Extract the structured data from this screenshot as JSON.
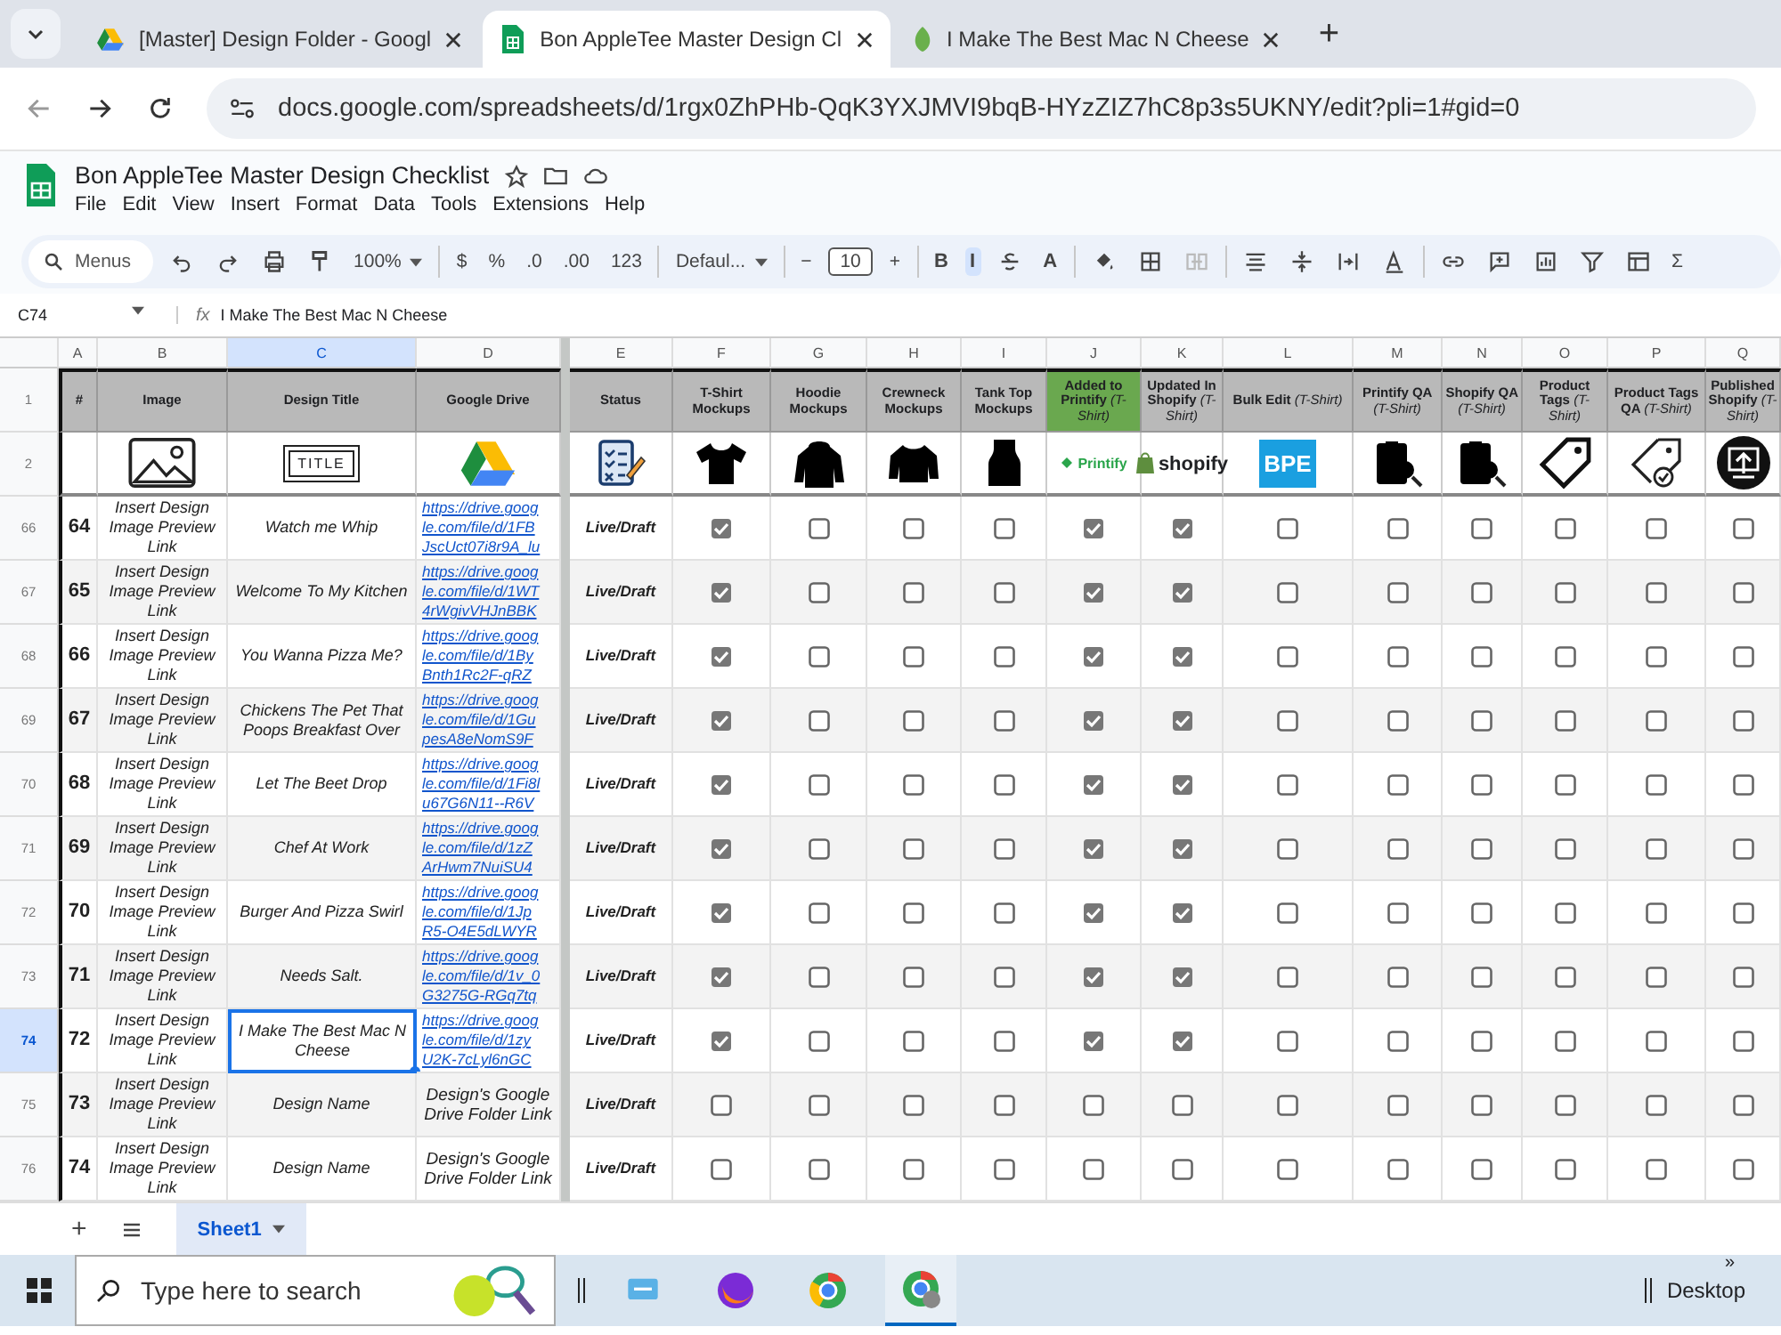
{
  "browser": {
    "tabs": [
      {
        "title": "[Master] Design Folder - Googl",
        "selected": false
      },
      {
        "title": "Bon AppleTee Master Design Cl",
        "selected": true
      },
      {
        "title": "I Make The Best Mac N Cheese",
        "selected": false
      }
    ],
    "new_tab": "+",
    "url": "docs.google.com/spreadsheets/d/1rgx0ZhPHb-QqK3YXJMVI9bqB-HYzZIZ7hC8p3s5UKNY/edit?pli=1#gid=0"
  },
  "document": {
    "title": "Bon AppleTee Master Design Checklist",
    "menus": [
      "File",
      "Edit",
      "View",
      "Insert",
      "Format",
      "Data",
      "Tools",
      "Extensions",
      "Help"
    ]
  },
  "toolbar": [
    {
      "kind": "search",
      "text": "Menus"
    },
    {
      "kind": "undo"
    },
    {
      "kind": "redo"
    },
    {
      "kind": "print"
    },
    {
      "kind": "paint"
    },
    {
      "kind": "dropdown",
      "text": "100%"
    },
    {
      "kind": "sep"
    },
    {
      "kind": "text",
      "text": "$"
    },
    {
      "kind": "text",
      "text": "%"
    },
    {
      "kind": "text",
      "text": ".0"
    },
    {
      "kind": "text",
      "text": ".00"
    },
    {
      "kind": "text",
      "text": "123"
    },
    {
      "kind": "sep"
    },
    {
      "kind": "dropdown",
      "text": "Defaul..."
    },
    {
      "kind": "sep"
    },
    {
      "kind": "text",
      "text": "−"
    },
    {
      "kind": "field",
      "text": "10"
    },
    {
      "kind": "text",
      "text": "+"
    },
    {
      "kind": "sep"
    },
    {
      "kind": "style",
      "text": "B",
      "selected": false
    },
    {
      "kind": "style",
      "text": "I",
      "selected": true
    },
    {
      "kind": "strike"
    },
    {
      "kind": "style",
      "text": "A",
      "selected": false
    },
    {
      "kind": "sep"
    },
    {
      "kind": "fill"
    },
    {
      "kind": "borders"
    },
    {
      "kind": "merge"
    },
    {
      "kind": "sep"
    },
    {
      "kind": "align"
    },
    {
      "kind": "valign"
    },
    {
      "kind": "wrap"
    },
    {
      "kind": "rotate"
    },
    {
      "kind": "sep"
    },
    {
      "kind": "link"
    },
    {
      "kind": "comment"
    },
    {
      "kind": "chart"
    },
    {
      "kind": "filter"
    },
    {
      "kind": "views"
    },
    {
      "kind": "text",
      "text": "Σ"
    }
  ],
  "formula_bar": {
    "cell": "C74",
    "fx": "fx",
    "value": "I Make The Best Mac N Cheese"
  },
  "columns": [
    {
      "letter": "A",
      "label": "#",
      "highlighted": false,
      "kind": "none",
      "selected": false
    },
    {
      "letter": "B",
      "label": "Image",
      "highlighted": false,
      "kind": "image",
      "selected": false
    },
    {
      "letter": "C",
      "label": "Design Title",
      "highlighted": false,
      "kind": "title",
      "logo_text": "TITLE",
      "selected": true
    },
    {
      "letter": "D",
      "label": "Google Drive",
      "highlighted": false,
      "kind": "drive",
      "selected": false
    },
    {
      "letter": "E",
      "label": "Status",
      "highlighted": false,
      "kind": "checklist",
      "selected": false
    },
    {
      "letter": "F",
      "label": "T-Shirt Mockups",
      "highlighted": false,
      "kind": "tshirt",
      "selected": false
    },
    {
      "letter": "G",
      "label": "Hoodie Mockups",
      "highlighted": false,
      "kind": "hoodie",
      "selected": false
    },
    {
      "letter": "H",
      "label": "Crewneck Mockups",
      "highlighted": false,
      "kind": "sweater",
      "selected": false
    },
    {
      "letter": "I",
      "label": "Tank Top Mockups",
      "highlighted": false,
      "kind": "tank",
      "selected": false
    },
    {
      "letter": "J",
      "label": "Added to Printify",
      "sub": "(T-Shirt)",
      "highlighted": true,
      "kind": "printify",
      "logo_text": "Printify",
      "selected": false
    },
    {
      "letter": "K",
      "label": "Updated In Shopify",
      "sub": "(T-Shirt)",
      "highlighted": false,
      "kind": "shopify",
      "logo_text": "shopify",
      "selected": false
    },
    {
      "letter": "L",
      "label": "Bulk Edit",
      "sub": "(T-Shirt)",
      "highlighted": false,
      "kind": "bpe",
      "logo_text": "BPE",
      "selected": false
    },
    {
      "letter": "M",
      "label": "Printify QA",
      "sub": "(T-Shirt)",
      "highlighted": false,
      "kind": "qa",
      "selected": false
    },
    {
      "letter": "N",
      "label": "Shopify QA",
      "sub": "(T-Shirt)",
      "highlighted": false,
      "kind": "qa",
      "selected": false
    },
    {
      "letter": "O",
      "label": "Product Tags",
      "sub": "(T-Shirt)",
      "highlighted": false,
      "kind": "tag",
      "selected": false
    },
    {
      "letter": "P",
      "label": "Product Tags QA",
      "sub": "(T-Shirt)",
      "highlighted": false,
      "kind": "tagcheck",
      "selected": false
    },
    {
      "letter": "Q",
      "label": "Published Shopify",
      "sub": "(T-Shirt)",
      "highlighted": false,
      "kind": "publish",
      "selected": false
    }
  ],
  "header_row_numbers": [
    "1",
    "2"
  ],
  "rows": [
    {
      "row": "66",
      "num": "64",
      "image": "Insert Design Image Preview Link",
      "title": "Watch me Whip",
      "kind": "link",
      "drive": [
        "https://drive.goog",
        "le.com/file/d/1FB",
        "JscUct07i8r9A_lu"
      ],
      "status": "Live/Draft",
      "selected": false,
      "checks": [
        true,
        false,
        false,
        false,
        true,
        true,
        false,
        false,
        false,
        false,
        false,
        false
      ]
    },
    {
      "row": "67",
      "num": "65",
      "image": "Insert Design Image Preview Link",
      "title": "Welcome To My Kitchen",
      "kind": "link",
      "drive": [
        "https://drive.goog",
        "le.com/file/d/1WT",
        "4rWgivVHJnBBK"
      ],
      "status": "Live/Draft",
      "selected": false,
      "checks": [
        true,
        false,
        false,
        false,
        true,
        true,
        false,
        false,
        false,
        false,
        false,
        false
      ]
    },
    {
      "row": "68",
      "num": "66",
      "image": "Insert Design Image Preview Link",
      "title": "You Wanna Pizza Me?",
      "kind": "link",
      "drive": [
        "https://drive.goog",
        "le.com/file/d/1By",
        "Bnth1Rc2F-qRZ"
      ],
      "status": "Live/Draft",
      "selected": false,
      "checks": [
        true,
        false,
        false,
        false,
        true,
        true,
        false,
        false,
        false,
        false,
        false,
        false
      ]
    },
    {
      "row": "69",
      "num": "67",
      "image": "Insert Design Image Preview Link",
      "title": "Chickens The Pet That Poops Breakfast Over",
      "kind": "link",
      "drive": [
        "https://drive.goog",
        "le.com/file/d/1Gu",
        "pesA8eNomS9F"
      ],
      "status": "Live/Draft",
      "selected": false,
      "checks": [
        true,
        false,
        false,
        false,
        true,
        true,
        false,
        false,
        false,
        false,
        false,
        false
      ]
    },
    {
      "row": "70",
      "num": "68",
      "image": "Insert Design Image Preview Link",
      "title": "Let The Beet Drop",
      "kind": "link",
      "drive": [
        "https://drive.goog",
        "le.com/file/d/1Fi8l",
        "u67G6N11--R6V"
      ],
      "status": "Live/Draft",
      "selected": false,
      "checks": [
        true,
        false,
        false,
        false,
        true,
        true,
        false,
        false,
        false,
        false,
        false,
        false
      ]
    },
    {
      "row": "71",
      "num": "69",
      "image": "Insert Design Image Preview Link",
      "title": "Chef At Work",
      "kind": "link",
      "drive": [
        "https://drive.goog",
        "le.com/file/d/1zZ",
        "ArHwm7NuiSU4"
      ],
      "status": "Live/Draft",
      "selected": false,
      "checks": [
        true,
        false,
        false,
        false,
        true,
        true,
        false,
        false,
        false,
        false,
        false,
        false
      ]
    },
    {
      "row": "72",
      "num": "70",
      "image": "Insert Design Image Preview Link",
      "title": "Burger And Pizza Swirl",
      "kind": "link",
      "drive": [
        "https://drive.goog",
        "le.com/file/d/1Jp",
        "R5-O4E5dLWYR"
      ],
      "status": "Live/Draft",
      "selected": false,
      "checks": [
        true,
        false,
        false,
        false,
        true,
        true,
        false,
        false,
        false,
        false,
        false,
        false
      ]
    },
    {
      "row": "73",
      "num": "71",
      "image": "Insert Design Image Preview Link",
      "title": "Needs Salt.",
      "kind": "link",
      "drive": [
        "https://drive.goog",
        "le.com/file/d/1v_0",
        "G3275G-RGq7tq"
      ],
      "status": "Live/Draft",
      "selected": false,
      "checks": [
        true,
        false,
        false,
        false,
        true,
        true,
        false,
        false,
        false,
        false,
        false,
        false
      ]
    },
    {
      "row": "74",
      "num": "72",
      "image": "Insert Design Image Preview Link",
      "title": "I Make The Best Mac N Cheese",
      "kind": "link",
      "drive": [
        "https://drive.goog",
        "le.com/file/d/1zy",
        "U2K-7cLyl6nGC"
      ],
      "status": "Live/Draft",
      "selected": true,
      "checks": [
        true,
        false,
        false,
        false,
        true,
        true,
        false,
        false,
        false,
        false,
        false,
        false
      ]
    },
    {
      "row": "75",
      "num": "73",
      "image": "Insert Design Image Preview Link",
      "title": "Design Name",
      "kind": "text",
      "drive": [
        "Design's Google Drive Folder Link"
      ],
      "status": "Live/Draft",
      "selected": false,
      "checks": [
        false,
        false,
        false,
        false,
        false,
        false,
        false,
        false,
        false,
        false,
        false,
        false
      ]
    },
    {
      "row": "76",
      "num": "74",
      "image": "Insert Design Image Preview Link",
      "title": "Design Name",
      "kind": "text",
      "drive": [
        "Design's Google Drive Folder Link"
      ],
      "status": "Live/Draft",
      "selected": false,
      "checks": [
        false,
        false,
        false,
        false,
        false,
        false,
        false,
        false,
        false,
        false,
        false,
        false
      ]
    }
  ],
  "sheet_tabs": {
    "add": "+",
    "list": [
      {
        "label": "Sheet1",
        "selected": true
      }
    ]
  },
  "taskbar": {
    "search_placeholder": "Type here to search",
    "desktop": "Desktop",
    "chevron": "»"
  }
}
